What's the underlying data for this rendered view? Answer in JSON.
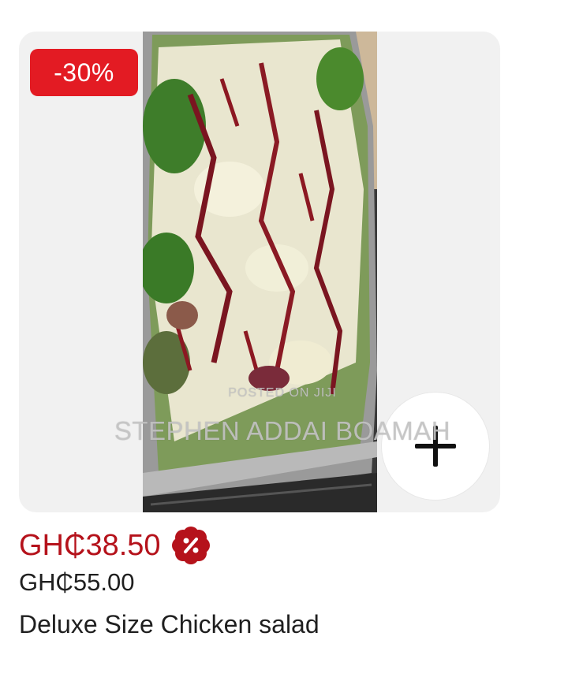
{
  "badge": {
    "discount": "-30%"
  },
  "watermark": {
    "posted": "POSTED ON JIJI",
    "seller": "STEPHEN ADDAI BOAMAH"
  },
  "product": {
    "price": "GH₵38.50",
    "old_price": "GH₵55.00",
    "name": "Deluxe Size Chicken salad"
  },
  "icons": {
    "add": "plus-icon",
    "promo": "discount-flower-icon"
  },
  "colors": {
    "badge": "#e31b23",
    "price": "#b5121b",
    "card": "#f1f1f1"
  }
}
